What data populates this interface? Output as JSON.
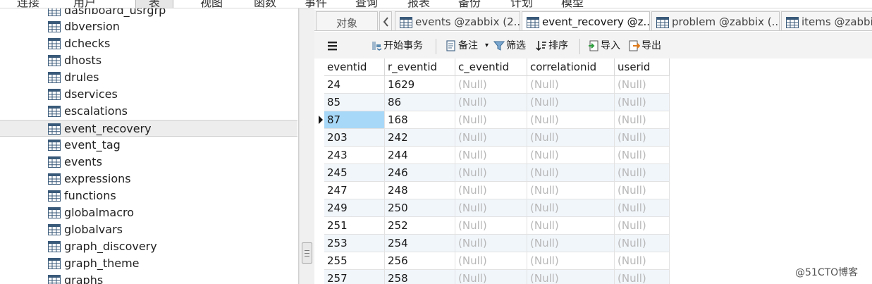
{
  "menubar": {
    "items": [
      "连接",
      "用户",
      "表",
      "视图",
      "函数",
      "事件",
      "查询",
      "报表",
      "备份",
      "计划",
      "模型"
    ]
  },
  "sidebar": {
    "items": [
      {
        "label": "dashboard_usrgrp"
      },
      {
        "label": "dbversion"
      },
      {
        "label": "dchecks"
      },
      {
        "label": "dhosts"
      },
      {
        "label": "drules"
      },
      {
        "label": "dservices"
      },
      {
        "label": "escalations"
      },
      {
        "label": "event_recovery",
        "selected": true
      },
      {
        "label": "event_tag"
      },
      {
        "label": "events"
      },
      {
        "label": "expressions"
      },
      {
        "label": "functions"
      },
      {
        "label": "globalmacro"
      },
      {
        "label": "globalvars"
      },
      {
        "label": "graph_discovery"
      },
      {
        "label": "graph_theme"
      },
      {
        "label": "graphs"
      }
    ]
  },
  "tabs": {
    "objects_label": "对象",
    "items": [
      {
        "label": "events @zabbix (2..."
      },
      {
        "label": "event_recovery @z...",
        "active": true
      },
      {
        "label": "problem @zabbix (..."
      },
      {
        "label": "items @zabbix"
      }
    ]
  },
  "toolbar": {
    "menu_icon": "hamburger-icon",
    "begin_transaction": "开始事务",
    "note": "备注",
    "filter": "筛选",
    "sort": "排序",
    "import": "导入",
    "export": "导出"
  },
  "grid": {
    "columns": [
      "eventid",
      "r_eventid",
      "c_eventid",
      "correlationid",
      "userid"
    ],
    "rows": [
      [
        "24",
        "1629",
        "(Null)",
        "(Null)",
        "(Null)"
      ],
      [
        "85",
        "86",
        "(Null)",
        "(Null)",
        "(Null)"
      ],
      [
        "87",
        "168",
        "(Null)",
        "(Null)",
        "(Null)"
      ],
      [
        "203",
        "242",
        "(Null)",
        "(Null)",
        "(Null)"
      ],
      [
        "243",
        "244",
        "(Null)",
        "(Null)",
        "(Null)"
      ],
      [
        "245",
        "246",
        "(Null)",
        "(Null)",
        "(Null)"
      ],
      [
        "247",
        "248",
        "(Null)",
        "(Null)",
        "(Null)"
      ],
      [
        "249",
        "250",
        "(Null)",
        "(Null)",
        "(Null)"
      ],
      [
        "251",
        "252",
        "(Null)",
        "(Null)",
        "(Null)"
      ],
      [
        "253",
        "254",
        "(Null)",
        "(Null)",
        "(Null)"
      ],
      [
        "255",
        "256",
        "(Null)",
        "(Null)",
        "(Null)"
      ],
      [
        "257",
        "258",
        "(Null)",
        "(Null)",
        "(Null)"
      ]
    ],
    "current_row": 2
  },
  "watermark": "@51CTO博客",
  "colors": {
    "selected_cell": "#a8d8f8",
    "alt_row": "#f1f6fb",
    "null_text": "#b8b8b8",
    "import_icon": "#2e9e3e",
    "export_icon": "#e07b1a"
  }
}
